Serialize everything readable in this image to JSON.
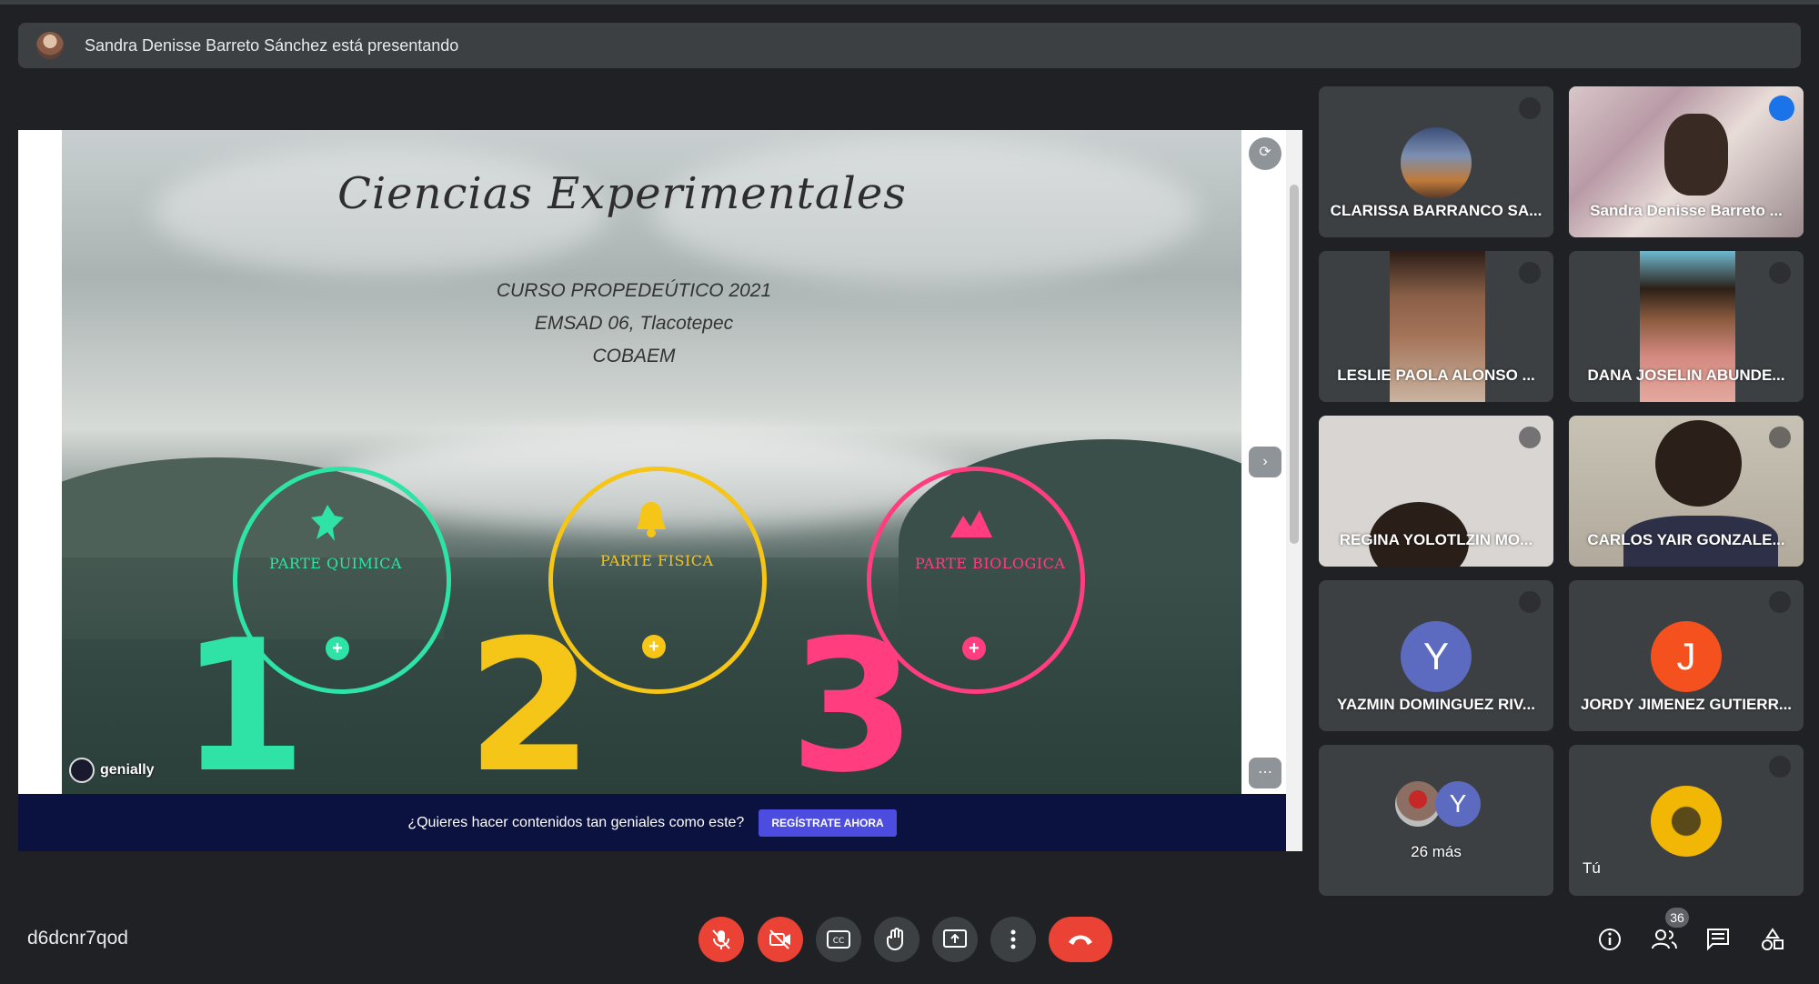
{
  "banner": {
    "presenting_text": "Sandra Denisse Barreto Sánchez está presentando"
  },
  "presentation": {
    "title": "Ciencias Experimentales",
    "subtitle_lines": [
      "CURSO PROPEDEÚTICO 2021",
      "EMSAD 06, Tlacotepec",
      "COBAEM"
    ],
    "parts": [
      {
        "number": "1",
        "label": "PARTE QUIMICA",
        "color": "#2fe3a7"
      },
      {
        "number": "2",
        "label": "PARTE FISICA",
        "color": "#f5c518"
      },
      {
        "number": "3",
        "label": "PARTE BIOLOGICA",
        "color": "#ff3d7f"
      }
    ],
    "brand": "genially",
    "cta_question": "¿Quieres hacer contenidos tan geniales como este?",
    "cta_button": "REGÍSTRATE AHORA"
  },
  "participants": [
    {
      "name": "CLARISSA BARRANCO SA...",
      "muted": true
    },
    {
      "name": "Sandra Denisse Barreto ...",
      "speaking": true
    },
    {
      "name": "LESLIE PAOLA ALONSO ...",
      "muted": true
    },
    {
      "name": "DANA JOSELIN ABUNDE...",
      "muted": true
    },
    {
      "name": "REGINA YOLOTLZIN MO...",
      "muted": true
    },
    {
      "name": "CARLOS YAIR GONZALE...",
      "muted": true
    },
    {
      "name": "YAZMIN DOMINGUEZ RIV...",
      "initial": "Y",
      "color": "#5c6bc0",
      "muted": true
    },
    {
      "name": "JORDY JIMENEZ GUTIERR...",
      "initial": "J",
      "color": "#f4511e",
      "muted": true
    }
  ],
  "more_tile": {
    "label": "26 más",
    "initial": "Y",
    "color": "#5c6bc0"
  },
  "self_tile": {
    "label": "Tú"
  },
  "meeting_code": "d6dcnr7qod",
  "participant_count": "36",
  "icons": {
    "mic": "mic-off-icon",
    "camera": "videocam-off-icon",
    "captions": "closed-captions-icon",
    "hand": "raise-hand-icon",
    "present": "present-screen-icon",
    "more": "more-vert-icon",
    "end": "call-end-icon",
    "info": "info-icon",
    "people": "people-icon",
    "chat": "chat-icon",
    "activities": "activities-icon"
  }
}
